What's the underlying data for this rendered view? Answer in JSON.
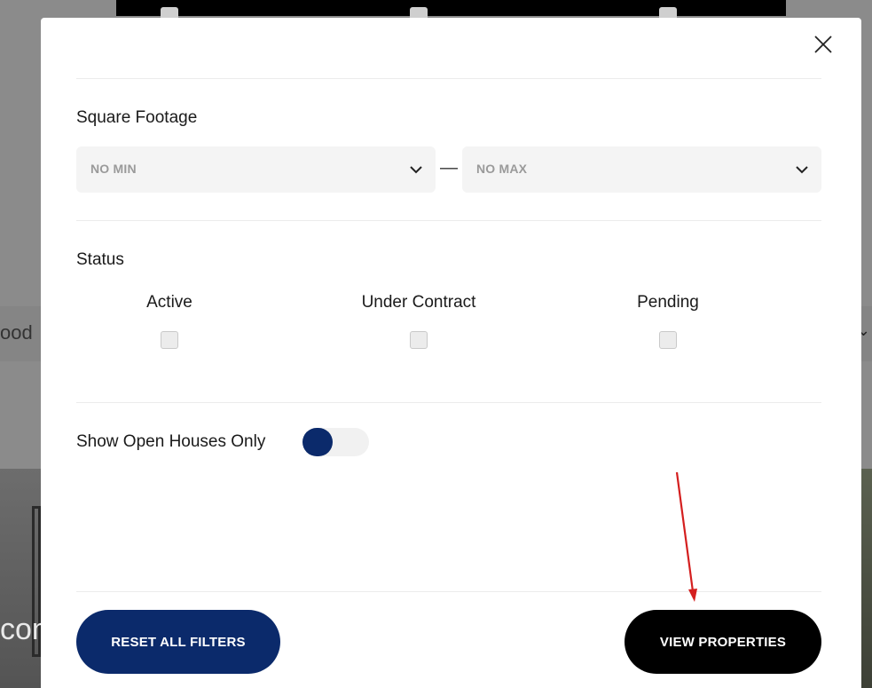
{
  "background": {
    "filter_bar_text": "ood",
    "photo_text": "con"
  },
  "modal": {
    "close_icon": "close-icon",
    "square_footage": {
      "title": "Square Footage",
      "min_value": "NO MIN",
      "max_value": "NO MAX",
      "separator": "—"
    },
    "status": {
      "title": "Status",
      "options": [
        {
          "label": "Active",
          "checked": false
        },
        {
          "label": "Under Contract",
          "checked": false
        },
        {
          "label": "Pending",
          "checked": false
        }
      ]
    },
    "open_houses": {
      "label": "Show Open Houses Only",
      "toggle_on": false
    },
    "buttons": {
      "reset": "RESET ALL FILTERS",
      "view": "VIEW PROPERTIES"
    }
  },
  "colors": {
    "primary_navy": "#0b2a6b",
    "black": "#000000",
    "annotation_red": "#d41f1f"
  }
}
